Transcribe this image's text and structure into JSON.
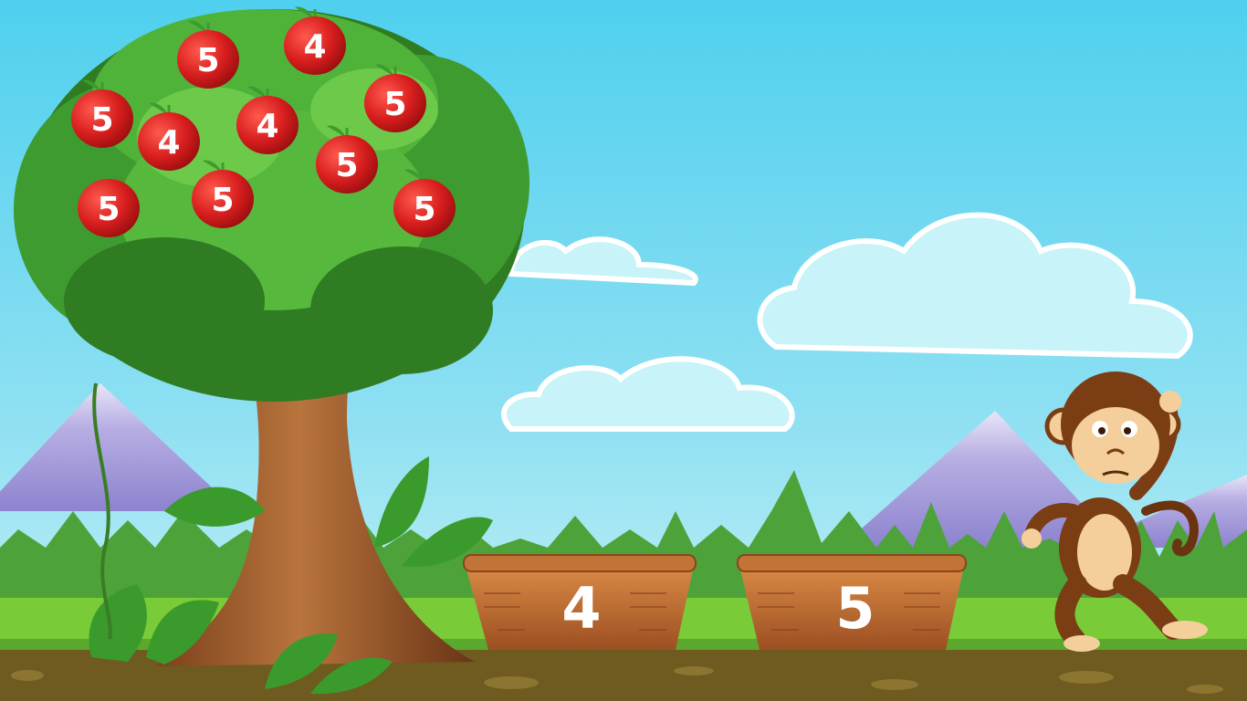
{
  "game": {
    "apples": [
      {
        "id": "a1",
        "number": "5"
      },
      {
        "id": "a2",
        "number": "4"
      },
      {
        "id": "a3",
        "number": "5"
      },
      {
        "id": "a4",
        "number": "5"
      },
      {
        "id": "a5",
        "number": "4"
      },
      {
        "id": "a6",
        "number": "4"
      },
      {
        "id": "a7",
        "number": "5"
      },
      {
        "id": "a8",
        "number": "5"
      },
      {
        "id": "a9",
        "number": "5"
      },
      {
        "id": "a10",
        "number": "5"
      }
    ],
    "baskets": [
      {
        "id": "b1",
        "label": "4"
      },
      {
        "id": "b2",
        "label": "5"
      }
    ]
  },
  "colors": {
    "sky_top": "#4fd0ee",
    "sky_bottom": "#bff0f6",
    "apple": "#d81e1e",
    "leaf_green": "#3e9b2f",
    "grass": "#7acb38",
    "soil": "#6f5a1f",
    "basket": "#b9632b"
  },
  "icons": {
    "character": "monkey-icon",
    "apple": "apple-icon",
    "basket": "basket-icon"
  }
}
